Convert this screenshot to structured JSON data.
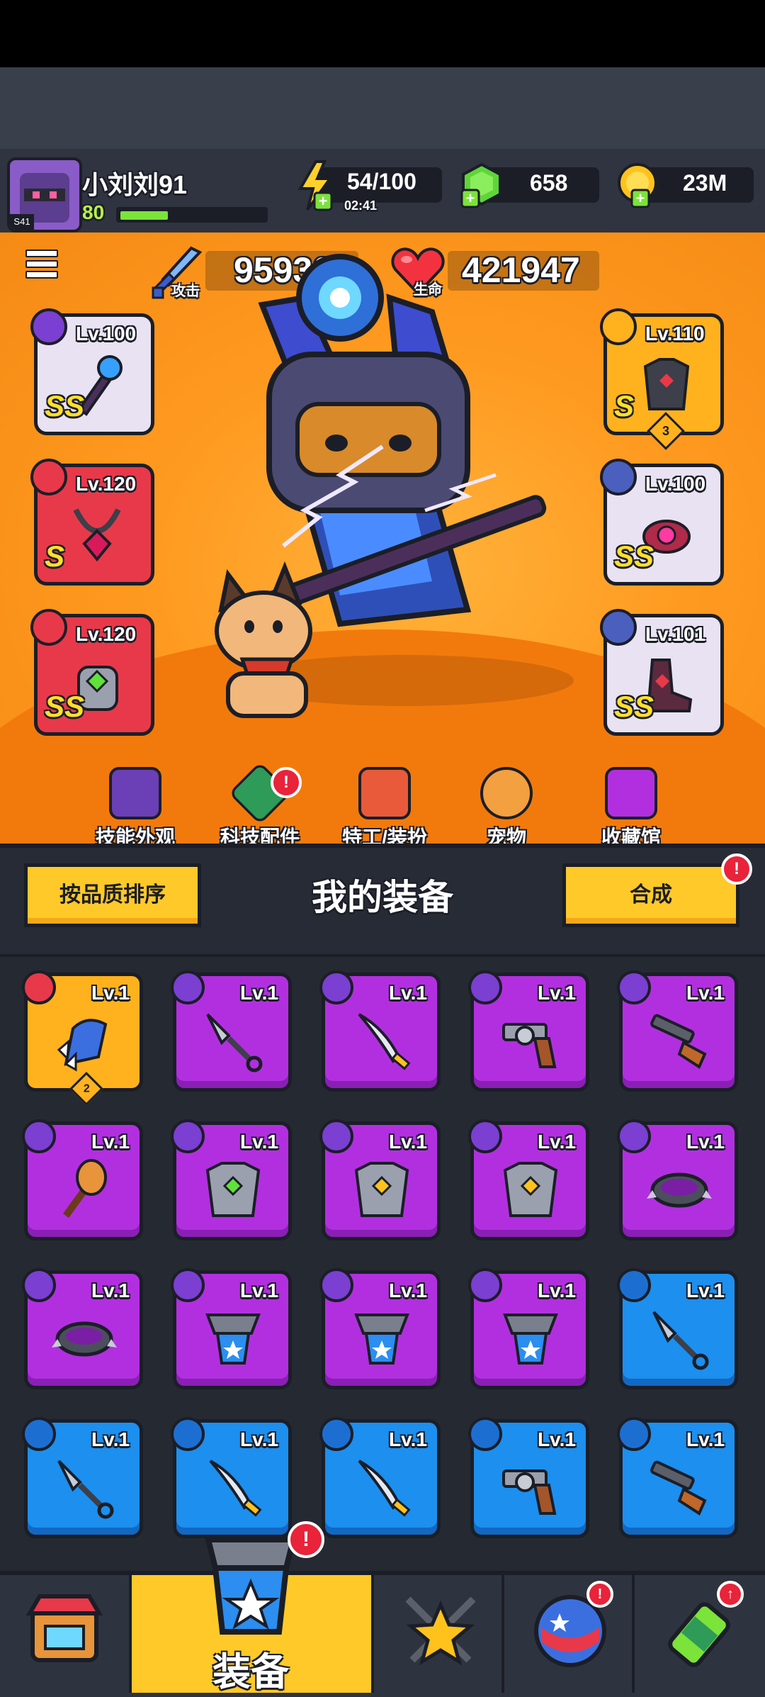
{
  "player": {
    "name": "小刘刘91",
    "level": "80",
    "avatar_tag": "S41",
    "xp_fraction": 0.33
  },
  "resources": {
    "energy": {
      "value": "54/100",
      "timer": "02:41",
      "icon": "lightning-plus-icon"
    },
    "gems": {
      "value": "658",
      "icon": "green-gem-plus-icon"
    },
    "coins": {
      "value": "23M",
      "icon": "gold-coin-plus-icon"
    }
  },
  "stats": {
    "attack": {
      "label": "攻击",
      "value": "95936"
    },
    "health": {
      "label": "生命",
      "value": "421947"
    }
  },
  "equipped": {
    "left": [
      {
        "level": "Lv.100",
        "grade": "SS",
        "item": "staff"
      },
      {
        "level": "Lv.120",
        "grade": "S",
        "item": "necklace"
      },
      {
        "level": "Lv.120",
        "grade": "SS",
        "item": "gauntlet"
      }
    ],
    "right": [
      {
        "level": "Lv.110",
        "grade": "S",
        "item": "armor",
        "stars": "3"
      },
      {
        "level": "Lv.100",
        "grade": "SS",
        "item": "ring"
      },
      {
        "level": "Lv.101",
        "grade": "SS",
        "item": "boots"
      }
    ]
  },
  "features": [
    {
      "label": "技能外观",
      "icon": "skill-skin-icon",
      "alert": false
    },
    {
      "label": "科技配件",
      "icon": "tech-part-icon",
      "alert": true,
      "alert_text": "!"
    },
    {
      "label": "特工/装扮",
      "icon": "agent-costume-icon",
      "alert": false
    },
    {
      "label": "宠物",
      "icon": "pet-icon",
      "alert": false
    },
    {
      "label": "收藏馆",
      "icon": "collection-icon",
      "alert": false
    }
  ],
  "inventory": {
    "title": "我的装备",
    "sort_button": "按品质排序",
    "merge_button": "合成",
    "merge_alert": "!",
    "items": [
      {
        "level": "Lv.1",
        "rarity": "gold",
        "icon": "claw-glove-icon",
        "count": "2"
      },
      {
        "level": "Lv.1",
        "rarity": "purple",
        "icon": "kunai-icon"
      },
      {
        "level": "Lv.1",
        "rarity": "purple",
        "icon": "sword-icon"
      },
      {
        "level": "Lv.1",
        "rarity": "purple",
        "icon": "revolver-icon"
      },
      {
        "level": "Lv.1",
        "rarity": "purple",
        "icon": "shotgun-icon"
      },
      {
        "level": "Lv.1",
        "rarity": "purple",
        "icon": "torch-staff-icon"
      },
      {
        "level": "Lv.1",
        "rarity": "purple",
        "icon": "gem-armor-icon"
      },
      {
        "level": "Lv.1",
        "rarity": "purple",
        "icon": "vest-armor-icon"
      },
      {
        "level": "Lv.1",
        "rarity": "purple",
        "icon": "plate-armor-icon"
      },
      {
        "level": "Lv.1",
        "rarity": "purple",
        "icon": "spiked-collar-icon"
      },
      {
        "level": "Lv.1",
        "rarity": "purple",
        "icon": "spiked-collar-icon"
      },
      {
        "level": "Lv.1",
        "rarity": "purple",
        "icon": "star-pendant-icon"
      },
      {
        "level": "Lv.1",
        "rarity": "purple",
        "icon": "star-belt-icon"
      },
      {
        "level": "Lv.1",
        "rarity": "purple",
        "icon": "star-belt-icon"
      },
      {
        "level": "Lv.1",
        "rarity": "blue",
        "icon": "kunai-icon"
      },
      {
        "level": "Lv.1",
        "rarity": "blue",
        "icon": "kunai-icon"
      },
      {
        "level": "Lv.1",
        "rarity": "blue",
        "icon": "sword-icon"
      },
      {
        "level": "Lv.1",
        "rarity": "blue",
        "icon": "sword-icon"
      },
      {
        "level": "Lv.1",
        "rarity": "blue",
        "icon": "revolver-icon"
      },
      {
        "level": "Lv.1",
        "rarity": "blue",
        "icon": "shotgun-icon"
      }
    ]
  },
  "nav": {
    "tabs": [
      {
        "icon": "shop-icon"
      },
      {
        "label": "装备",
        "icon": "equipment-icon",
        "active": true,
        "alert_text": "!"
      },
      {
        "icon": "star-swords-icon"
      },
      {
        "icon": "planet-icon",
        "alert_text": "!"
      },
      {
        "icon": "gene-potion-icon",
        "alert_arrow": "↑"
      }
    ]
  },
  "colors": {
    "gold": "#ffb21d",
    "purple": "#b22fe0",
    "blue": "#1c8fef",
    "red": "#e8394a",
    "orange_bg": "#ff9a20"
  }
}
